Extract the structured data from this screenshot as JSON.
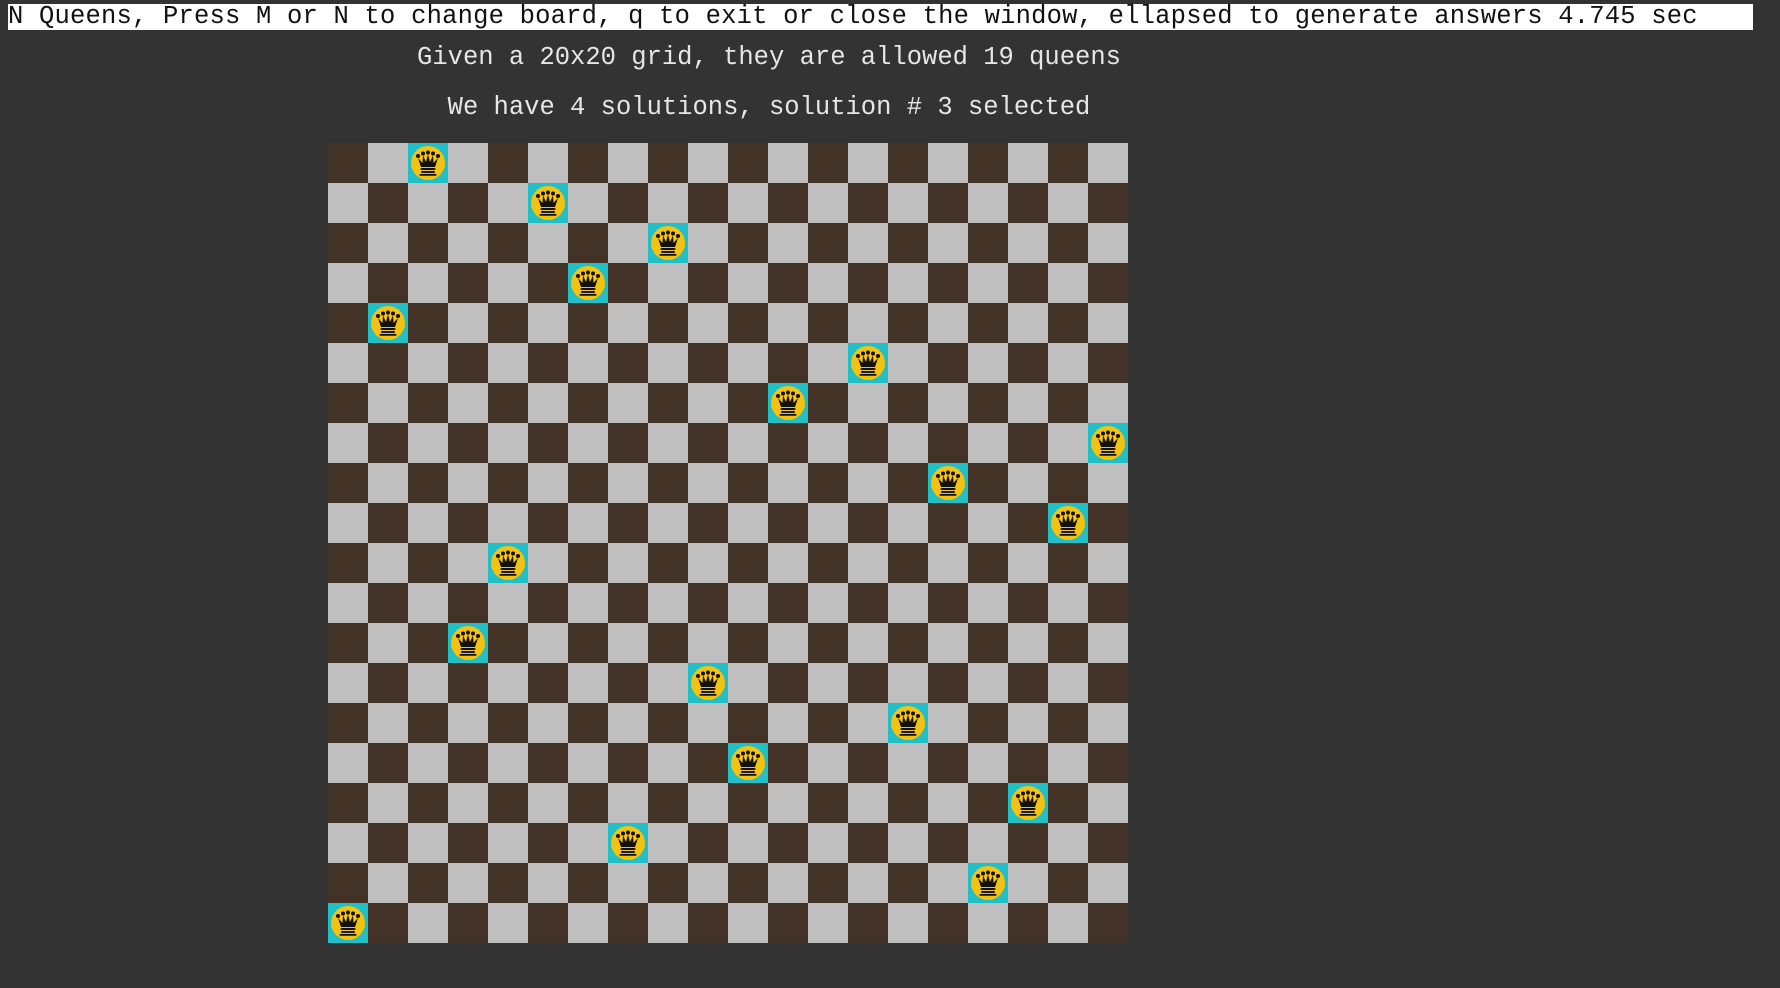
{
  "header": {
    "title": "N Queens, Press M or N to change board, q to exit or close the window, ellapsed to generate answers 4.745 sec",
    "info_line_1": "Given a 20x20 grid, they are allowed 19 queens",
    "info_line_2": "We have 4 solutions, solution # 3 selected"
  },
  "board": {
    "rows": 20,
    "cols": 20,
    "colors": {
      "dark": "#433226",
      "light": "#bfbfbf",
      "queen_highlight": "#21c0c6",
      "queen_disc": "#f5c20f",
      "queen_glyph": "#111111"
    },
    "queen_icon": "crown-icon",
    "queens": [
      {
        "row": 0,
        "col": 2
      },
      {
        "row": 1,
        "col": 5
      },
      {
        "row": 2,
        "col": 8
      },
      {
        "row": 3,
        "col": 6
      },
      {
        "row": 4,
        "col": 1
      },
      {
        "row": 5,
        "col": 13
      },
      {
        "row": 6,
        "col": 11
      },
      {
        "row": 7,
        "col": 19
      },
      {
        "row": 8,
        "col": 15
      },
      {
        "row": 9,
        "col": 18
      },
      {
        "row": 10,
        "col": 4
      },
      {
        "row": 12,
        "col": 3
      },
      {
        "row": 13,
        "col": 9
      },
      {
        "row": 14,
        "col": 14
      },
      {
        "row": 15,
        "col": 10
      },
      {
        "row": 16,
        "col": 17
      },
      {
        "row": 17,
        "col": 7
      },
      {
        "row": 18,
        "col": 16
      },
      {
        "row": 19,
        "col": 0
      }
    ]
  }
}
